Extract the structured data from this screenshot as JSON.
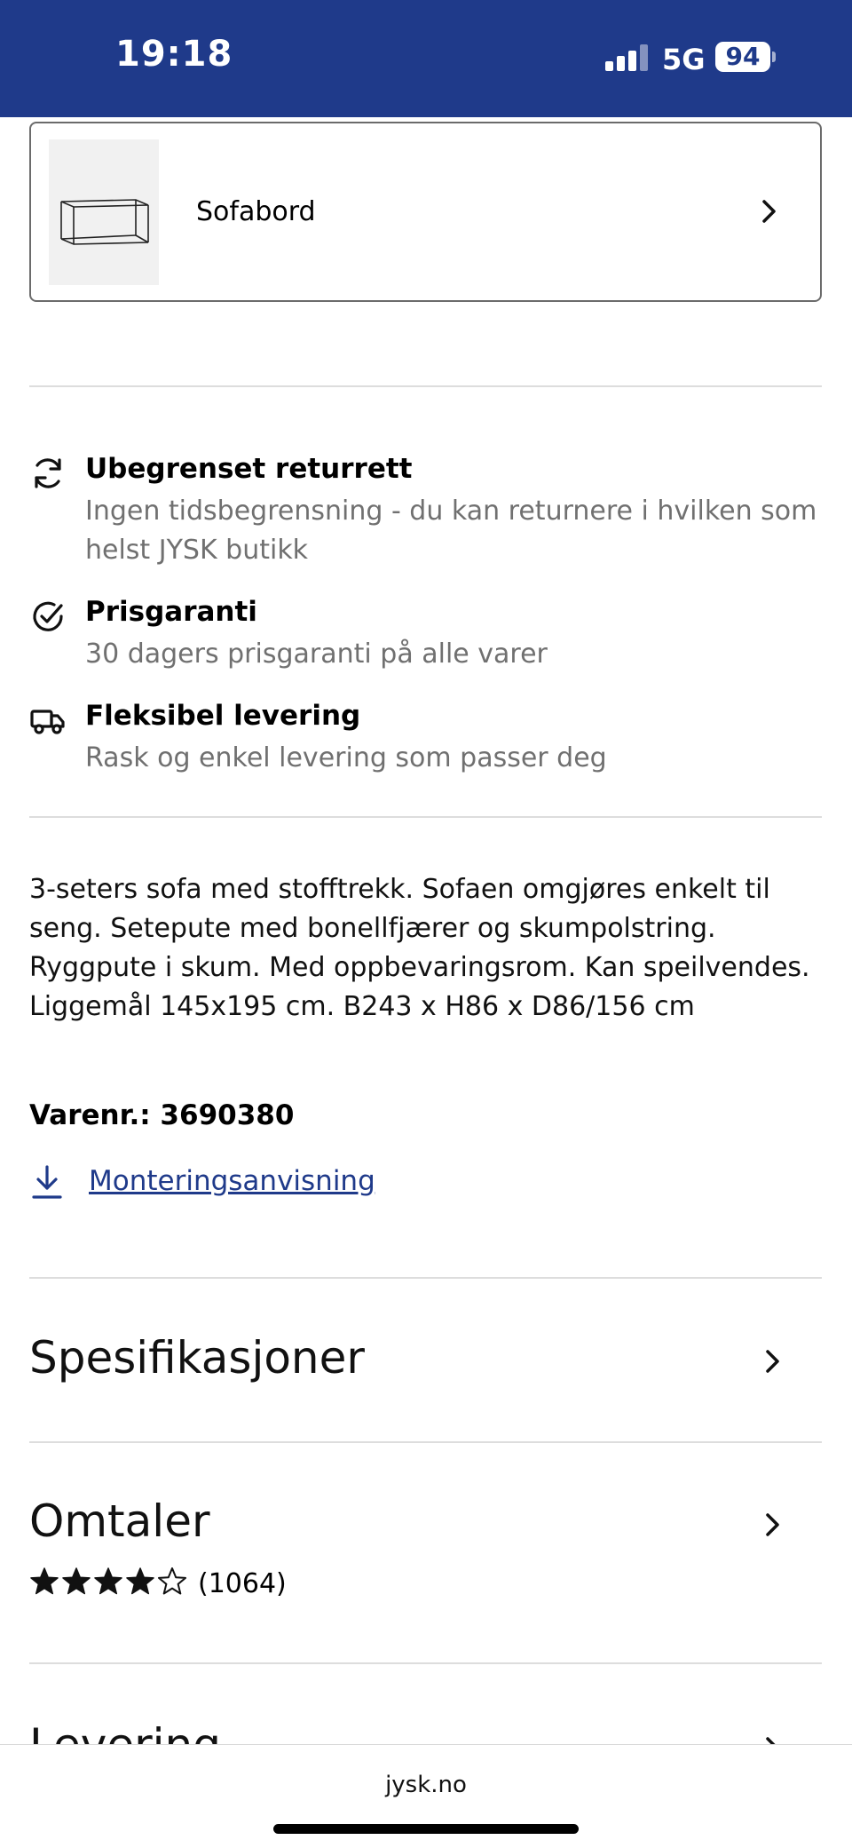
{
  "status_bar": {
    "time": "19:18",
    "network": "5G",
    "battery": "94"
  },
  "related_product": {
    "name": "Sofabord",
    "icon": "coffee-table-thumbnail"
  },
  "usps": [
    {
      "icon": "refresh-icon",
      "title": "Ubegrenset returrett",
      "desc": "Ingen tidsbegrensning - du kan returnere i hvilken som helst JYSK butikk"
    },
    {
      "icon": "check-circle-icon",
      "title": "Prisgaranti",
      "desc": "30 dagers prisgaranti på alle varer"
    },
    {
      "icon": "truck-icon",
      "title": "Fleksibel levering",
      "desc": "Rask og enkel levering som passer deg"
    }
  ],
  "description": "3-seters sofa med stofftrekk. Sofaen omgjøres enkelt til seng. Setepute med bonellfjærer og skumpolstring. Ryggpute i skum. Med oppbevaringsrom. Kan speilvendes. Liggemål 145x195 cm. B243 x H86 x D86/156 cm",
  "sku": "Varenr.: 3690380",
  "manual": {
    "label": "Monteringsanvisning",
    "icon": "download-icon"
  },
  "accordions": {
    "specs": "Spesifikasjoner",
    "reviews": "Omtaler",
    "delivery": "Levering"
  },
  "reviews": {
    "rating": 4,
    "max": 5,
    "count": "(1064)"
  },
  "url_bar": {
    "url": "jysk.no"
  },
  "colors": {
    "brand_blue": "#1f3a8a",
    "muted_text": "#707070",
    "divider": "#dddddd"
  }
}
